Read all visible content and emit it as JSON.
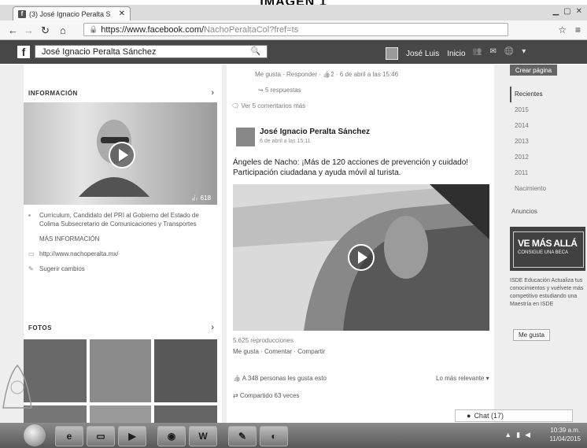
{
  "caption": "IMAGEN 1",
  "browser": {
    "tab_title": "(3) José Ignacio Peralta S",
    "url_main": "https://www.facebook.com/",
    "url_path": "NachoPeraltaCol?fref=ts"
  },
  "fb": {
    "search_value": "José Ignacio Peralta Sánchez",
    "nav_user": "José Luis",
    "nav_home": "Inicio"
  },
  "left": {
    "info_heading": "INFORMACIÓN",
    "video_stats": "618",
    "info_items": [
      {
        "icon": "briefcase-icon",
        "text": "Curriculum, Candidato del PRI al Gobierno del Estado de Colima Subsecretario de Comunicaciones y Transportes"
      },
      {
        "icon": "more-info-icon",
        "text": "MÁS INFORMACIÓN"
      },
      {
        "icon": "link-icon",
        "text": "http://www.nachoperalta.mx/"
      },
      {
        "icon": "pencil-icon",
        "text": "Sugerir cambios"
      }
    ],
    "photos_heading": "FOTOS"
  },
  "middle": {
    "prev_actions": "Me gusta · Responder · 👍2 · 6 de abril a las 15:46",
    "replies": "5 respuestas",
    "view_more": "Ver 5 comentarios más",
    "post": {
      "author": "José Ignacio Peralta Sánchez",
      "time": "6 de abril a las 15:11",
      "text": "Ángeles de Nacho: ¡Más de 120 acciones de prevención y cuidado! Participación ciudadana y ayuda móvil al turista.",
      "views": "5.625 reproducciones",
      "actions": "Me gusta · Comentar · Compartir",
      "likes": "A 348 personas les gusta esto",
      "shares": "Compartido 63 veces",
      "sort": "Lo más relevante"
    }
  },
  "right": {
    "button": "Crear página",
    "years": [
      "Recientes",
      "2015",
      "2014",
      "2013",
      "2012",
      "2011",
      "Nacimiento"
    ],
    "ad_label": "Anuncios",
    "ad_headline": "VE MÁS ALLÁ",
    "ad_sub": "CONSIGUE UNA BECA",
    "ad_text": "ISDE Educación Actualiza tus conocimientos y vuélvete más competitivo estudiando una Maestría en ISDE",
    "like_btn": "Me gusta"
  },
  "chat": "Chat (17)",
  "taskbar": {
    "clock_time": "10:39 a.m.",
    "clock_date": "11/04/2015",
    "word_label": "W"
  }
}
